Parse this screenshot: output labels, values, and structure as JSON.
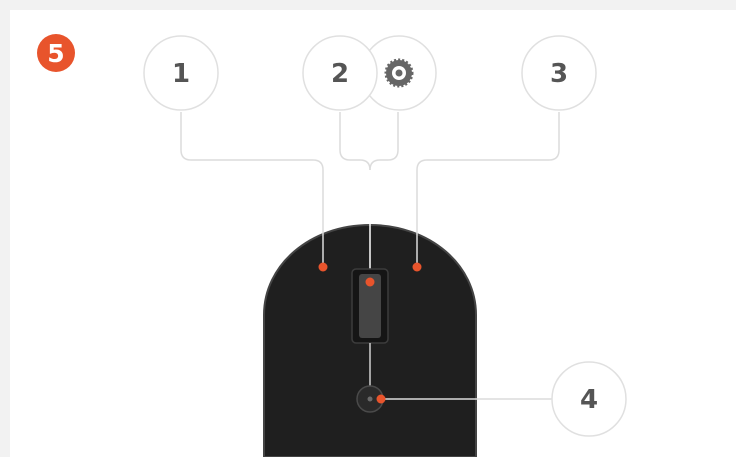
{
  "badge": {
    "label": "5",
    "color": "#e8542c"
  },
  "callouts": [
    {
      "id": "left-button",
      "label": "1"
    },
    {
      "id": "scroll-wheel",
      "label": "2"
    },
    {
      "id": "right-button",
      "label": "3"
    },
    {
      "id": "dpi-button",
      "label": "4"
    }
  ],
  "icons": {
    "gear": "gear-icon"
  },
  "colors": {
    "accent": "#e8542c",
    "mouse_body": "#1f1f1f",
    "leader_line": "#dcdcdc",
    "callout_border": "#e0e0e0",
    "callout_text": "#555555"
  }
}
